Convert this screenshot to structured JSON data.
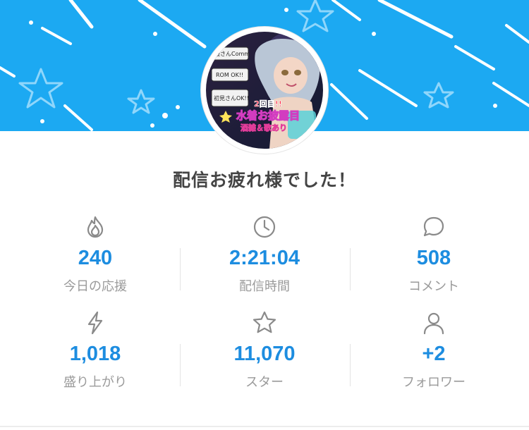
{
  "headline": "配信お疲れ様でした！",
  "colors": {
    "banner": "#1ca9f2",
    "value": "#1d8de0",
    "label": "#9a9a9a",
    "headline": "#444444"
  },
  "avatar": {
    "text_lines": [
      "2回目!!",
      "水着お披露目",
      "酒雑＆歌あり"
    ],
    "side_labels": [
      "最さんComm",
      "ROM OK!!",
      "初見さんOK!!"
    ]
  },
  "stats": [
    {
      "icon": "flame-icon",
      "value": "240",
      "label": "今日の応援"
    },
    {
      "icon": "clock-icon",
      "value": "2:21:04",
      "label": "配信時間"
    },
    {
      "icon": "speech-bubble-icon",
      "value": "508",
      "label": "コメント"
    },
    {
      "icon": "lightning-icon",
      "value": "1,018",
      "label": "盛り上がり"
    },
    {
      "icon": "star-icon",
      "value": "11,070",
      "label": "スター"
    },
    {
      "icon": "person-icon",
      "value": "+2",
      "label": "フォロワー"
    }
  ]
}
